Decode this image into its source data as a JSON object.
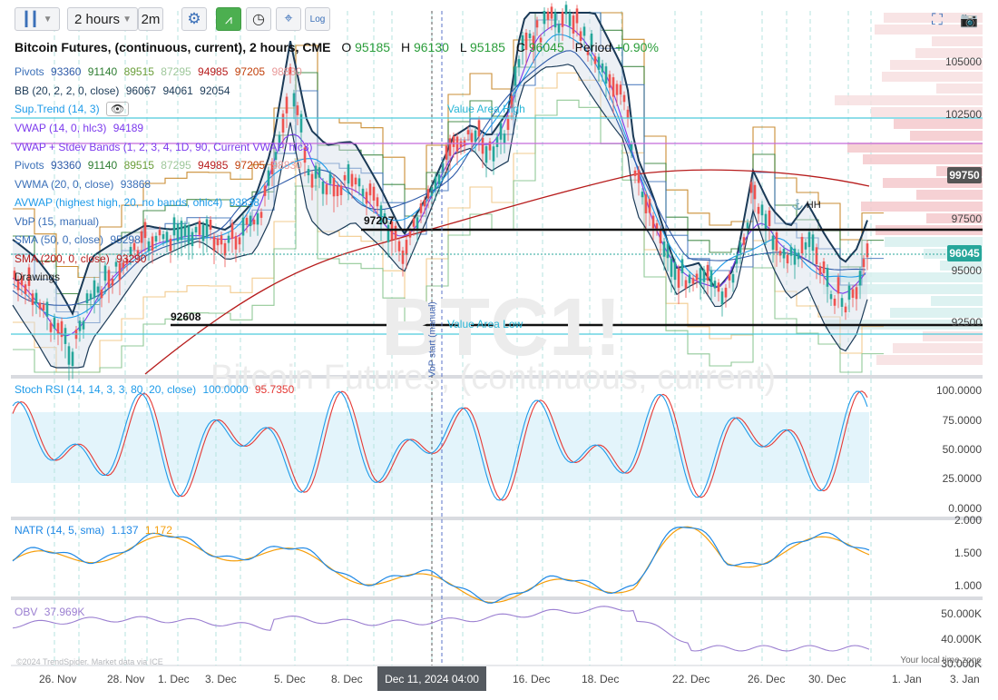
{
  "toolbar": {
    "interval": "2 hours",
    "minutes": "2m",
    "log": "Log"
  },
  "header": {
    "title": "Bitcoin Futures, (continuous, current), 2 hours, CME",
    "o_label": "O",
    "o": "95185",
    "h_label": "H",
    "h": "96130",
    "l_label": "L",
    "l": "95185",
    "c_label": "C",
    "c": "96045",
    "period_label": "Period",
    "period": "+0.90%"
  },
  "overlays": {
    "pivots": {
      "label": "Pivots",
      "values": [
        "93360",
        "91140",
        "89515",
        "87295",
        "94985",
        "97205",
        "98830"
      ]
    },
    "bb": {
      "label": "BB (20, 2, 2, 0, close)",
      "values": [
        "96067",
        "94061",
        "92054"
      ]
    },
    "supertrend": {
      "label": "Sup.Trend (14, 3)"
    },
    "vwap": {
      "label": "VWAP (14, 0, hlc3)",
      "value": "94189"
    },
    "vwap_bands": {
      "label": "VWAP + Stdev Bands (1, 2, 3, 4, 1D, 90, Current VWAP, hlc3)"
    },
    "pivots2": {
      "label": "Pivots",
      "values": [
        "93360",
        "91140",
        "89515",
        "87295",
        "94985",
        "97205",
        "98830"
      ]
    },
    "vwma": {
      "label": "VWMA (20, 0, close)",
      "value": "93868"
    },
    "avwap": {
      "label": "AVWAP (highest high, 20, no bands, ohlc4)",
      "value": "93838"
    },
    "vbp": {
      "label": "VbP (15, manual)"
    },
    "sma50": {
      "label": "SMA (50, 0, close)",
      "value": "95298"
    },
    "sma200": {
      "label": "SMA (200, 0, close)",
      "value": "93290"
    },
    "drawings": {
      "label": "Drawings"
    }
  },
  "price_axis": [
    "105000",
    "102500",
    "100000",
    "97500",
    "95000",
    "92500"
  ],
  "price_badges": {
    "upper": "99750",
    "current": "96045"
  },
  "annotations": {
    "level_high": "97207",
    "level_low": "92608",
    "value_area_high": "Value Area High",
    "value_area_low": "Value Area Low",
    "vbp_start": "VbP start (manual)",
    "hh": "HH"
  },
  "watermark": {
    "symbol": "BTC1!",
    "name": "Bitcoin Futures, (continuous, current)"
  },
  "stoch_rsi": {
    "label": "Stoch RSI (14, 14, 3, 3, 80, 20, close)",
    "k": "100.0000",
    "d": "95.7350",
    "axis": [
      "100.0000",
      "75.0000",
      "50.0000",
      "25.0000",
      "0.0000"
    ]
  },
  "natr": {
    "label": "NATR (14, 5, sma)",
    "v1": "1.137",
    "v2": "1.172",
    "axis": [
      "2.000",
      "1.500",
      "1.000"
    ]
  },
  "obv": {
    "label": "OBV",
    "value": "37.969K",
    "axis": [
      "50.000K",
      "40.000K",
      "30.000K"
    ]
  },
  "footer": {
    "copyright": "©2024 TrendSpider. Market data via ICE",
    "timezone": "Your local time zone"
  },
  "x_axis": [
    "26. Nov",
    "28. Nov",
    "1. Dec",
    "3. Dec",
    "5. Dec",
    "8. Dec",
    "16. Dec",
    "18. Dec",
    "22. Dec",
    "26. Dec",
    "30. Dec",
    "1. Jan",
    "3. Jan"
  ],
  "cursor_date": "Dec 11, 2024 04:00",
  "colors": {
    "bb": "#1b3a57",
    "vwap": "#7c3aed",
    "pivot_green": "#2e7d32",
    "pivot_orange": "#c17a10",
    "sma200": "#b71c1c",
    "stoch_k": "#1e9be9",
    "stoch_d": "#e53935",
    "natr1": "#1e88e5",
    "natr2": "#f59e0b",
    "obv": "#9b7fd1",
    "up": "#26a69a",
    "down": "#ef5350",
    "badge_current": "#26a69a",
    "badge_upper": "#555555"
  }
}
